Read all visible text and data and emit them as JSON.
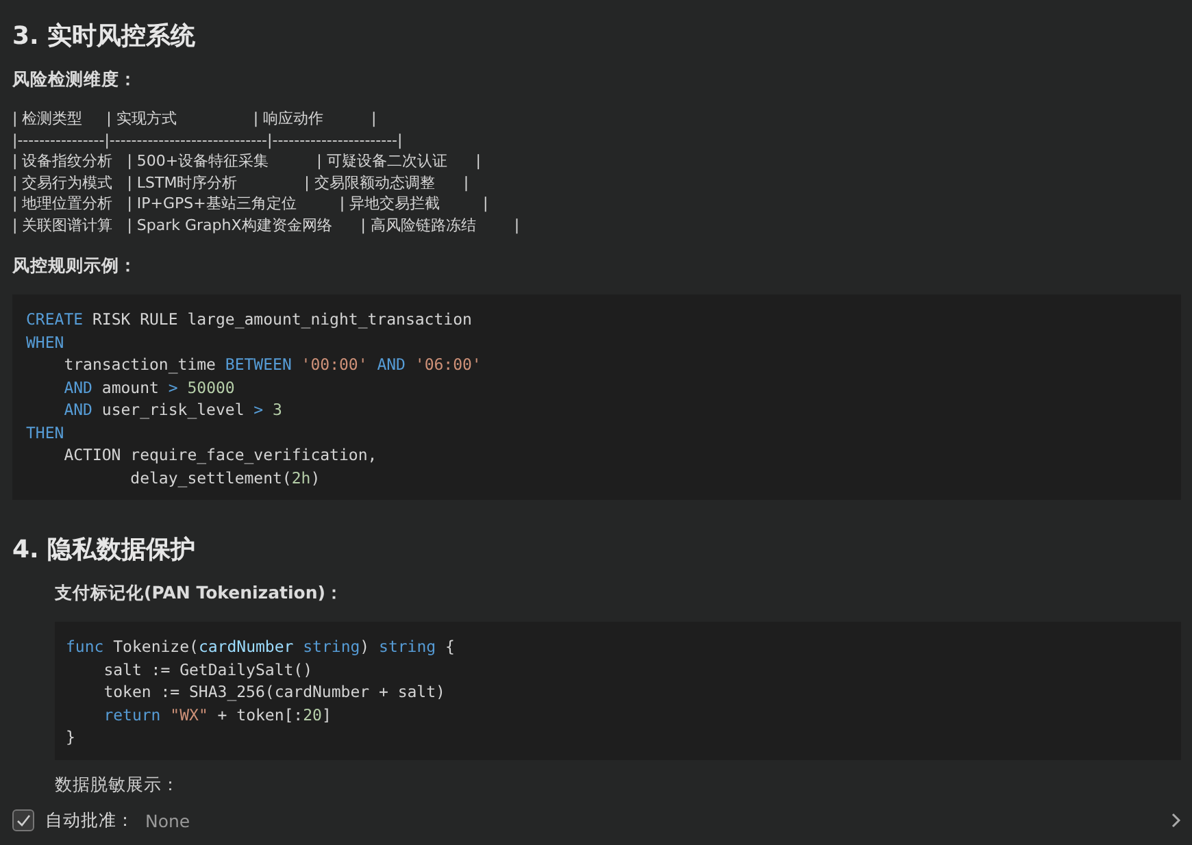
{
  "sections": [
    {
      "heading": "3. 实时风控系统",
      "blocks": [
        {
          "kind": "label",
          "text": "风险检测维度：",
          "indented": false
        },
        {
          "kind": "pre",
          "indented": false,
          "lines": [
            "| 检测类型     | 实现方式                | 响应动作          |",
            "|----------------|-----------------------------|-----------------------|",
            "| 设备指纹分析   | 500+设备特征采集          | 可疑设备二次认证      |",
            "| 交易行为模式   | LSTM时序分析              | 交易限额动态调整      |",
            "| 地理位置分析   | IP+GPS+基站三角定位         | 异地交易拦截         |",
            "| 关联图谱计算   | Spark GraphX构建资金网络      | 高风险链路冻结        |"
          ]
        },
        {
          "kind": "label",
          "text": "风控规则示例：",
          "indented": false
        },
        {
          "kind": "code",
          "indented": false,
          "lines": [
            [
              {
                "text": "CREATE",
                "kind": "kw"
              },
              {
                "text": " RISK RULE large_amount_night_transaction",
                "kind": "plain"
              }
            ],
            [
              {
                "text": "WHEN",
                "kind": "kw"
              }
            ],
            [
              {
                "text": "    transaction_time ",
                "kind": "plain"
              },
              {
                "text": "BETWEEN ",
                "kind": "kw"
              },
              {
                "text": "'00:00' ",
                "kind": "str"
              },
              {
                "text": "AND ",
                "kind": "kw"
              },
              {
                "text": "'06:00'",
                "kind": "str"
              }
            ],
            [
              {
                "text": "    AND",
                "kind": "kw"
              },
              {
                "text": " amount ",
                "kind": "plain"
              },
              {
                "text": "> ",
                "kind": "kw"
              },
              {
                "text": "50000",
                "kind": "num"
              }
            ],
            [
              {
                "text": "    AND",
                "kind": "kw"
              },
              {
                "text": " user_risk_level ",
                "kind": "plain"
              },
              {
                "text": "> ",
                "kind": "kw"
              },
              {
                "text": "3",
                "kind": "num"
              }
            ],
            [
              {
                "text": "THEN",
                "kind": "kw"
              }
            ],
            [
              {
                "text": "    ACTION require_face_verification,",
                "kind": "plain"
              }
            ],
            [
              {
                "text": "           delay_settlement(",
                "kind": "plain"
              },
              {
                "text": "2h",
                "kind": "num"
              },
              {
                "text": ")",
                "kind": "plain"
              }
            ]
          ]
        }
      ]
    },
    {
      "heading": "4. 隐私数据保护",
      "blocks": [
        {
          "kind": "label",
          "text": "支付标记化(PAN Tokenization)：",
          "indented": true
        },
        {
          "kind": "code",
          "indented": true,
          "lines": [
            [
              {
                "text": "func",
                "kind": "kw"
              },
              {
                "text": " Tokenize(",
                "kind": "plain"
              },
              {
                "text": "cardNumber ",
                "kind": "param"
              },
              {
                "text": "string",
                "kind": "kw"
              },
              {
                "text": ") ",
                "kind": "plain"
              },
              {
                "text": "string",
                "kind": "kw"
              },
              {
                "text": " {",
                "kind": "plain"
              }
            ],
            [
              {
                "text": "    salt := GetDailySalt()",
                "kind": "plain"
              }
            ],
            [
              {
                "text": "    token := SHA3_256(cardNumber + salt)",
                "kind": "plain"
              }
            ],
            [
              {
                "text": "    return ",
                "kind": "kw"
              },
              {
                "text": "\"WX\"",
                "kind": "str"
              },
              {
                "text": " + token[:",
                "kind": "plain"
              },
              {
                "text": "20",
                "kind": "num"
              },
              {
                "text": "]",
                "kind": "plain"
              }
            ],
            [
              {
                "text": "}",
                "kind": "plain"
              }
            ]
          ]
        },
        {
          "kind": "plain",
          "text": "数据脱敏展示：",
          "indented": true
        }
      ]
    }
  ],
  "approval": {
    "label": "自动批准：",
    "value": "None",
    "checked": true
  }
}
